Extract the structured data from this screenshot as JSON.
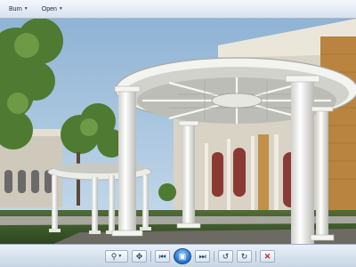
{
  "menubar": {
    "items": [
      {
        "label": "Burn"
      },
      {
        "label": "Open"
      }
    ]
  },
  "viewport": {
    "scene": "sketchup-pavilion-render",
    "colors": {
      "sky": "#a9c8e2",
      "grass": "#3c5a2a",
      "column": "#f1f1ee",
      "building": "#d8d2c4",
      "brick": "#b98745"
    }
  },
  "statusbar": {
    "left_text": "",
    "right_text": ""
  },
  "toolbar": {
    "buttons": [
      {
        "name": "zoom-icon",
        "glyph": "⚲"
      },
      {
        "name": "pan-icon",
        "glyph": "✥"
      },
      {
        "name": "previous-icon",
        "glyph": "⏮"
      },
      {
        "name": "slideshow-play-icon",
        "glyph": "▣"
      },
      {
        "name": "next-icon",
        "glyph": "⏭"
      },
      {
        "name": "rotate-left-icon",
        "glyph": "↺"
      },
      {
        "name": "rotate-right-icon",
        "glyph": "↻"
      },
      {
        "name": "delete-icon",
        "glyph": "✕"
      }
    ]
  }
}
